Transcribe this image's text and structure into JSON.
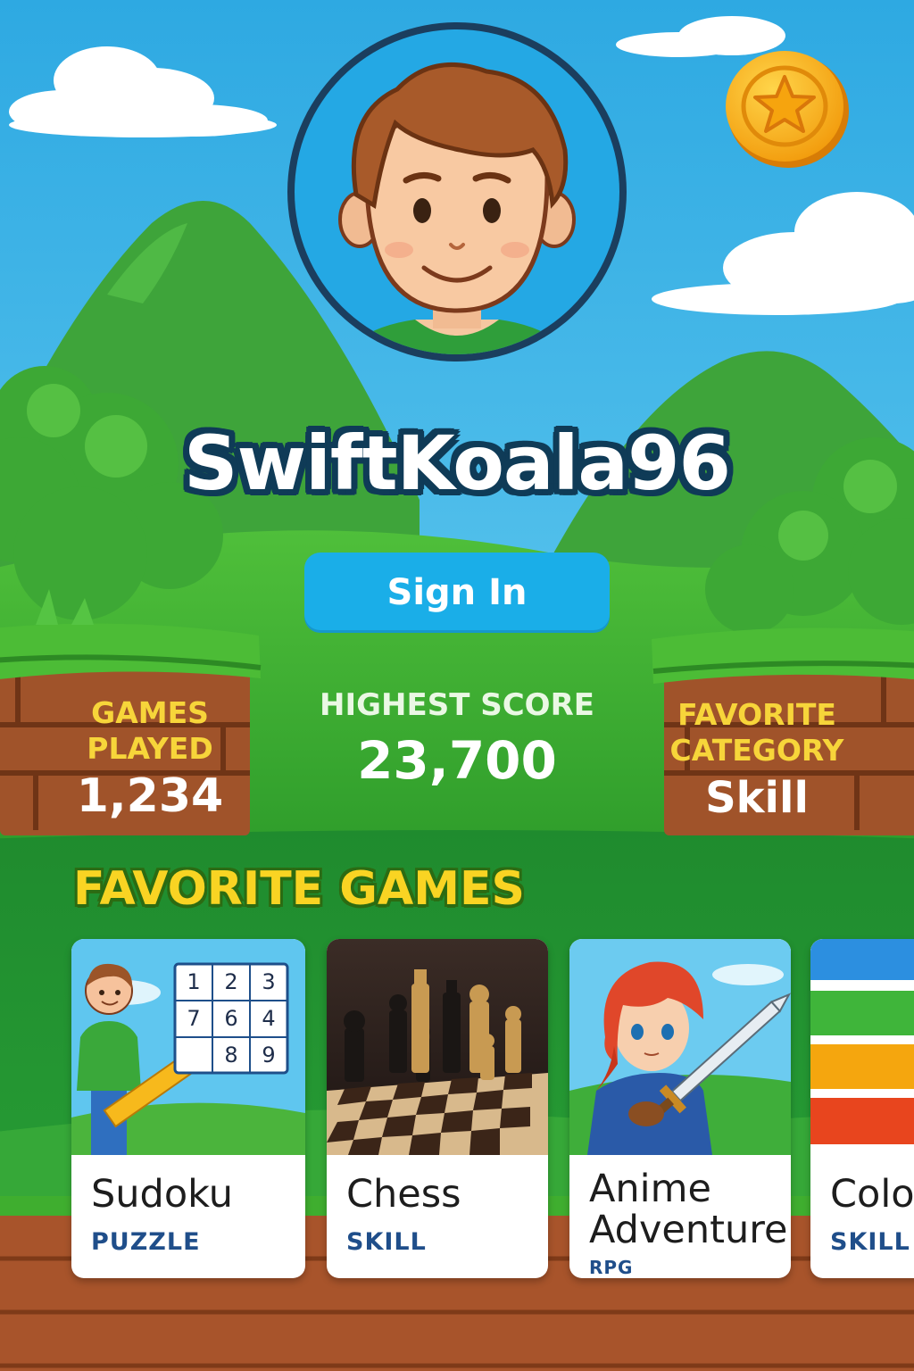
{
  "profile": {
    "username": "SwiftKoala96",
    "sign_in_label": "Sign In"
  },
  "stats": {
    "games_played": {
      "label_line1": "GAMES",
      "label_line2": "PLAYED",
      "value": "1,234"
    },
    "highest_score": {
      "label": "HIGHEST SCORE",
      "value": "23,700"
    },
    "favorite_category": {
      "label_line1": "FAVORITE",
      "label_line2": "CATEGORY",
      "value": "Skill"
    }
  },
  "favorites": {
    "title": "FAVORITE GAMES",
    "cards": [
      {
        "title": "Sudoku",
        "category": "PUZZLE",
        "grid": [
          "1",
          "2",
          "3",
          "7",
          "6",
          "4",
          "",
          "8",
          "9"
        ]
      },
      {
        "title": "Chess",
        "category": "SKILL"
      },
      {
        "title_line1": "Anime",
        "title_line2": "Adventure",
        "category": "RPG"
      },
      {
        "title": "Colo",
        "category": "SKILL"
      }
    ]
  },
  "colors": {
    "sky_top": "#2ea9e2",
    "sky_bottom": "#8fdcf2",
    "grass": "#3fae2f",
    "accent_blue": "#1aaee8",
    "label_yellow": "#f7d53a",
    "coin": "#f8b416"
  },
  "icons": [
    "coin-star-icon",
    "avatar"
  ]
}
